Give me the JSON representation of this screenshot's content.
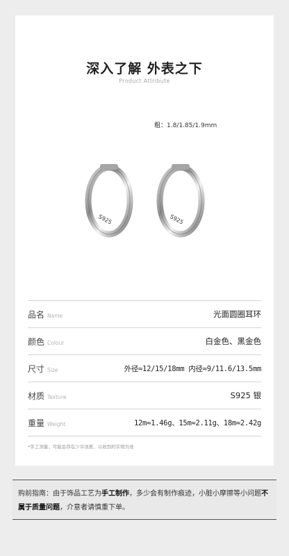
{
  "header": {
    "title": "深入了解 外表之下",
    "subtitle": "Product Attribute"
  },
  "thickness_text": "粗：1.8/1.85/1.9mm",
  "ring_engraving": "S925",
  "specs": [
    {
      "label_cn": "品名",
      "label_en": "Name",
      "value": "光面圆圈耳环"
    },
    {
      "label_cn": "颜色",
      "label_en": "Colour",
      "value": "白金色、黑金色"
    },
    {
      "label_cn": "尺寸",
      "label_en": "Size",
      "value": "外径≈12/15/18mm 内径≈9/11.6/13.5mm"
    },
    {
      "label_cn": "材质",
      "label_en": "Texture",
      "value": "S925 银"
    },
    {
      "label_cn": "重量",
      "label_en": "Weight",
      "value": "12m≈1.46g、15m≈2.11g、18m≈2.42g"
    }
  ],
  "note": "*手工测量，可能会存在少许误差，以收到的实物为准",
  "footer": {
    "part1": "购前指南：由于饰品工艺为",
    "bold1": "手工制作",
    "part2": "，多少会有制作痕迹，小脏小摩擦等小问题",
    "bold2": "不属于质量问题",
    "part3": "，介意者请慎重下单。"
  },
  "colors": {
    "background": "#ededed",
    "card": "#ffffff",
    "ring": "#9a9a9a"
  }
}
